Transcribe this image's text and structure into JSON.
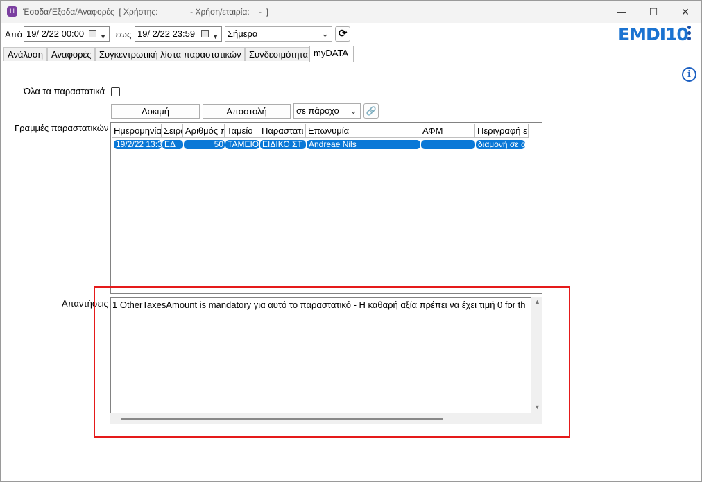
{
  "window": {
    "title": "Έσοδα/Έξοδα/Αναφορές  [ Χρήστης:              - Χρήση/εταιρία:    -  ]",
    "minimize_glyph": "—",
    "maximize_glyph": "☐",
    "close_glyph": "✕",
    "app_icon_glyph": "lıl"
  },
  "toolbar": {
    "from_label": "Από",
    "from_value": "19/  2/22 00:00",
    "to_label": "εως",
    "to_value": "19/  2/22 23:59",
    "period_value": "Σήμερα",
    "refresh_glyph": "⟳"
  },
  "logo": {
    "text": "EMDI10",
    "color": "#1b73d1"
  },
  "tabs": [
    "Ανάλυση",
    "Αναφορές",
    "Συγκεντρωτική λίστα παραστατικών",
    "Συνδεσιμότητα",
    "myDATA"
  ],
  "mydata": {
    "all_docs_label": "Όλα τα παραστατικά",
    "all_docs_checked": false,
    "test_button": "Δοκιμή",
    "send_button": "Αποστολή",
    "provider_value": "σε πάροχο",
    "link_glyph": "🔗",
    "lines_label": "Γραμμές παραστατικών",
    "columns": [
      "Ημερομηνία",
      "Σειρά",
      "Αριθμός π",
      "Ταμείο",
      "Παραστατι",
      "Επωνυμία",
      "ΑΦΜ",
      "Περιγραφή ε"
    ],
    "rows": [
      [
        "19/2/22 13:3",
        "ΕΔ",
        "50",
        "ΤΑΜΕΙΟ",
        "ΕΙΔΙΚΟ ΣΤ",
        "Andreae Nils",
        "",
        "διαμονή σε ο"
      ]
    ],
    "responses_label": "Απαντήσεις",
    "response_text": "1 OtherTaxesAmount is mandatory για αυτό το παραστατικό - Η καθαρή αξία πρέπει να έχει τιμή 0 for th",
    "info_glyph": "i",
    "highlight_color": "#e51a1a",
    "selection_color": "#0a78d7"
  }
}
